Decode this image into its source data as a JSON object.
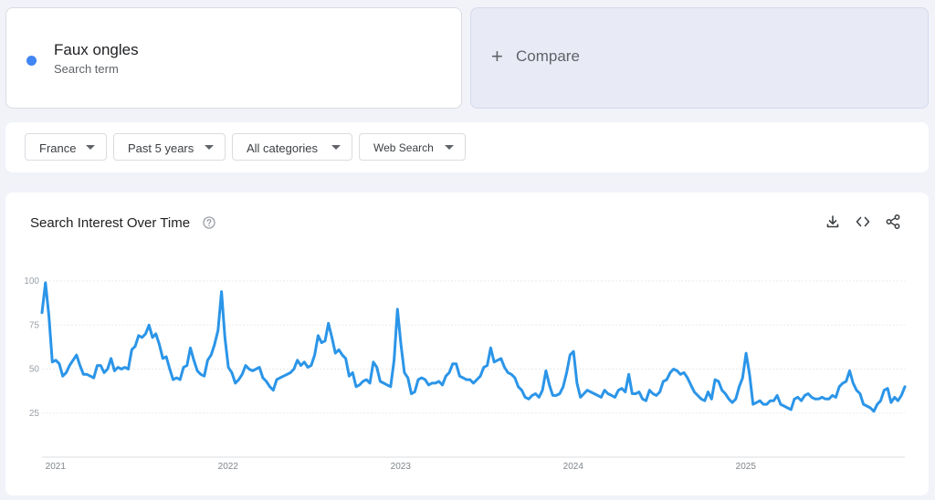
{
  "search_term": {
    "name": "Faux ongles",
    "subtitle": "Search term",
    "color": "#4285f4"
  },
  "compare": {
    "icon": "plus-icon",
    "label": "Compare"
  },
  "filters": {
    "geo": "France",
    "time": "Past 5 years",
    "category": "All categories",
    "property": "Web Search"
  },
  "chart_card": {
    "title": "Search Interest Over Time",
    "icons": [
      "help-circle-icon",
      "download-icon",
      "embed-code-icon",
      "share-icon"
    ]
  },
  "chart_data": {
    "type": "line",
    "title": "Search Interest Over Time",
    "xlabel": "",
    "ylabel": "",
    "ylim": [
      0,
      100
    ],
    "xlim": [
      2020.97,
      2025.97
    ],
    "yticks": [
      25,
      50,
      75,
      100
    ],
    "xticks": [
      "2021",
      "2022",
      "2023",
      "2024",
      "2025"
    ],
    "grid": true,
    "line_color": "#2b95e8",
    "series": [
      {
        "values": [
          82,
          99,
          80,
          54,
          55,
          53,
          46,
          48,
          52,
          55,
          58,
          52,
          47,
          47,
          46,
          45,
          52,
          52,
          48,
          50,
          56,
          49,
          51,
          50,
          51,
          50,
          61,
          63,
          69,
          68,
          70,
          75,
          68,
          70,
          64,
          56,
          57,
          50,
          44,
          45,
          44,
          51,
          52,
          62,
          55,
          49,
          47,
          46,
          55,
          58,
          64,
          72,
          94,
          68,
          51,
          48,
          42,
          44,
          47,
          52,
          50,
          49,
          50,
          51,
          45,
          43,
          40,
          38,
          44,
          45,
          46,
          47,
          48,
          50,
          55,
          52,
          54,
          51,
          52,
          58,
          69,
          65,
          66,
          76,
          68,
          59,
          61,
          58,
          56,
          46,
          48,
          40,
          41,
          43,
          44,
          42,
          54,
          51,
          43,
          42,
          41,
          40,
          55,
          84,
          64,
          48,
          45,
          36,
          37,
          44,
          45,
          44,
          41,
          42,
          42,
          43,
          41,
          46,
          48,
          53,
          53,
          46,
          45,
          44,
          44,
          42,
          44,
          46,
          51,
          52,
          62,
          54,
          55,
          56,
          51,
          48,
          47,
          45,
          40,
          38,
          34,
          33,
          35,
          36,
          34,
          38,
          49,
          41,
          35,
          35,
          36,
          40,
          48,
          58,
          60,
          42,
          34,
          36,
          38,
          37,
          36,
          35,
          34,
          38,
          36,
          35,
          34,
          38,
          39,
          37,
          47,
          36,
          36,
          37,
          33,
          32,
          38,
          36,
          35,
          37,
          43,
          44,
          48,
          50,
          49,
          47,
          48,
          45,
          41,
          37,
          35,
          33,
          32,
          37,
          33,
          44,
          43,
          38,
          36,
          33,
          31,
          33,
          40,
          45,
          59,
          47,
          30,
          31,
          32,
          30,
          30,
          32,
          32,
          35,
          30,
          29,
          28,
          27,
          33,
          34,
          32,
          35,
          36,
          34,
          33,
          33,
          34,
          33,
          33,
          35,
          34,
          40,
          42,
          43,
          49,
          42,
          38,
          36,
          30,
          29,
          28,
          26,
          30,
          32,
          38,
          39,
          31,
          34,
          32,
          35,
          40
        ]
      }
    ]
  }
}
